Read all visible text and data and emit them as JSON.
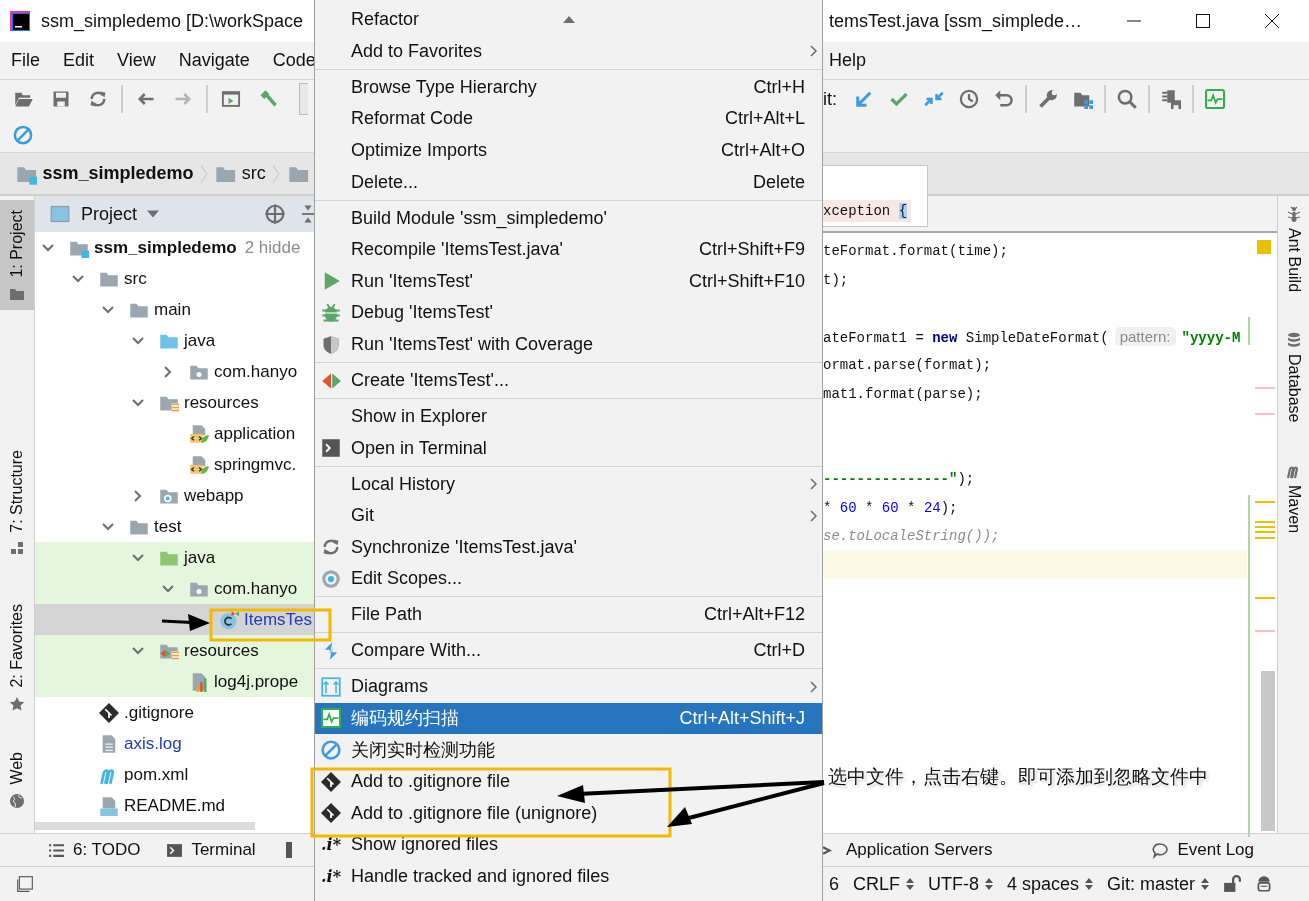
{
  "title_bar": {
    "left_title": "ssm_simpledemo [D:\\workSpace",
    "right_title": "temsTest.java [ssm_simplede…"
  },
  "menu_bar": {
    "left": [
      "File",
      "Edit",
      "View",
      "Navigate",
      "Code"
    ],
    "right": [
      "Help"
    ]
  },
  "toolbar": {
    "vcs_label": "it:"
  },
  "breadcrumb": [
    "ssm_simpledemo",
    "src"
  ],
  "left_stripe": [
    {
      "label": "1: Project",
      "selected": true
    },
    {
      "label": "7: Structure",
      "selected": false
    },
    {
      "label": "2: Favorites",
      "selected": false
    },
    {
      "label": "Web",
      "selected": false
    }
  ],
  "project_panel": {
    "title": "Project",
    "tree": [
      {
        "label": "ssm_simpledemo",
        "note": "2 hidde",
        "kind": "module",
        "expanded": true,
        "selected": false,
        "tinted": false,
        "modified": false,
        "children": [
          {
            "label": "src",
            "kind": "folder",
            "expanded": true,
            "selected": false,
            "tinted": false,
            "modified": false,
            "children": [
              {
                "label": "main",
                "kind": "folder",
                "expanded": true,
                "selected": false,
                "tinted": false,
                "modified": false,
                "children": [
                  {
                    "label": "java",
                    "kind": "source-root",
                    "expanded": true,
                    "selected": false,
                    "tinted": false,
                    "modified": false,
                    "children": [
                      {
                        "label": "com.hanyo",
                        "kind": "package",
                        "expanded": false,
                        "selected": false,
                        "tinted": false,
                        "modified": false
                      }
                    ]
                  },
                  {
                    "label": "resources",
                    "kind": "resources",
                    "expanded": true,
                    "selected": false,
                    "tinted": false,
                    "modified": false,
                    "children": [
                      {
                        "label": "application",
                        "kind": "spring-xml",
                        "selected": false,
                        "tinted": false,
                        "modified": false
                      },
                      {
                        "label": "springmvc.",
                        "kind": "spring-xml",
                        "selected": false,
                        "tinted": false,
                        "modified": false
                      }
                    ]
                  },
                  {
                    "label": "webapp",
                    "kind": "web-folder",
                    "expanded": false,
                    "selected": false,
                    "tinted": false,
                    "modified": false
                  }
                ]
              },
              {
                "label": "test",
                "kind": "folder",
                "expanded": true,
                "selected": false,
                "tinted": false,
                "modified": false,
                "children": [
                  {
                    "label": "java",
                    "kind": "test-root",
                    "expanded": true,
                    "selected": false,
                    "tinted": true,
                    "modified": false,
                    "children": [
                      {
                        "label": "com.hanyo",
                        "kind": "package",
                        "expanded": true,
                        "selected": false,
                        "tinted": true,
                        "modified": false,
                        "children": [
                          {
                            "label": "ItemsTes",
                            "kind": "test-class",
                            "selected": true,
                            "tinted": false,
                            "modified": true
                          }
                        ]
                      }
                    ]
                  },
                  {
                    "label": "resources",
                    "kind": "test-resources",
                    "expanded": true,
                    "selected": false,
                    "tinted": true,
                    "modified": false,
                    "children": [
                      {
                        "label": "log4j.prope",
                        "kind": "properties",
                        "selected": false,
                        "tinted": true,
                        "modified": false
                      }
                    ]
                  }
                ]
              }
            ]
          },
          {
            "label": ".gitignore",
            "kind": "git",
            "selected": false,
            "tinted": false,
            "modified": false
          },
          {
            "label": "axis.log",
            "kind": "log",
            "selected": false,
            "tinted": false,
            "modified": true
          },
          {
            "label": "pom.xml",
            "kind": "maven",
            "selected": false,
            "tinted": false,
            "modified": false
          },
          {
            "label": "README.md",
            "kind": "markdown",
            "selected": false,
            "tinted": false,
            "modified": false
          }
        ]
      }
    ]
  },
  "editor": {
    "sticky_line": {
      "text": "xception",
      "brace": "{"
    },
    "lines": [
      {
        "current": false,
        "tokens": [
          {
            "text": "teFormat.format(time);",
            "kind": "plain"
          }
        ]
      },
      {
        "current": false,
        "tokens": [
          {
            "text": "t);",
            "kind": "plain"
          }
        ]
      },
      {
        "current": false
      },
      {
        "current": false,
        "tokens": [
          {
            "text": "ateFormat1 = ",
            "kind": "plain"
          },
          {
            "text": "new",
            "kind": "keyword"
          },
          {
            "text": " SimpleDateFormat(",
            "kind": "plain"
          },
          {
            "text": "pattern:",
            "kind": "hint"
          },
          {
            "text": "\"yyyy-M",
            "kind": "string"
          }
        ]
      },
      {
        "current": false,
        "tokens": [
          {
            "text": "ormat.parse(format);",
            "kind": "plain"
          }
        ]
      },
      {
        "current": false,
        "tokens": [
          {
            "text": "mat1.format(parse);",
            "kind": "plain"
          }
        ]
      },
      {
        "current": false
      },
      {
        "current": false
      },
      {
        "current": false,
        "tokens": [
          {
            "text": "---------------\"",
            "kind": "string"
          },
          {
            "text": ");",
            "kind": "plain"
          }
        ]
      },
      {
        "current": false,
        "tokens": [
          {
            "text": "* ",
            "kind": "plain"
          },
          {
            "text": "60",
            "kind": "number"
          },
          {
            "text": " * ",
            "kind": "plain"
          },
          {
            "text": "60",
            "kind": "number"
          },
          {
            "text": " * ",
            "kind": "plain"
          },
          {
            "text": "24",
            "kind": "number"
          },
          {
            "text": ");",
            "kind": "plain"
          }
        ]
      },
      {
        "current": false,
        "tokens": [
          {
            "text": "se.toLocaleString());",
            "kind": "deprecated"
          }
        ]
      },
      {
        "current": true
      }
    ]
  },
  "right_stripe": [
    {
      "label": "Ant Build",
      "kind": "ant"
    },
    {
      "label": "Database",
      "kind": "database"
    },
    {
      "label": "Maven",
      "kind": "maven"
    }
  ],
  "tool_windows": {
    "left": [
      {
        "label": "6: TODO",
        "kind": "list"
      },
      {
        "label": "Terminal",
        "kind": "terminal"
      }
    ],
    "right": [
      {
        "label": "Application Servers",
        "kind": "servers"
      },
      {
        "label": "Event Log",
        "kind": "bubble"
      }
    ]
  },
  "status_bar": {
    "items": [
      {
        "text": "6",
        "dropdown": false
      },
      {
        "text": "CRLF",
        "dropdown": true
      },
      {
        "text": "UTF-8",
        "dropdown": true
      },
      {
        "text": "4 spaces",
        "dropdown": true
      },
      {
        "text": "Git: master",
        "dropdown": true
      }
    ]
  },
  "context_menu": {
    "scroll_up": true,
    "groups": [
      [
        {
          "label": "Refactor",
          "submenu": false,
          "selected": false
        },
        {
          "label": "Add to Favorites",
          "submenu": true,
          "selected": false
        }
      ],
      [
        {
          "label": "Browse Type Hierarchy",
          "shortcut": "Ctrl+H",
          "submenu": false,
          "selected": false
        },
        {
          "label": "Reformat Code",
          "shortcut": "Ctrl+Alt+L",
          "submenu": false,
          "selected": false
        },
        {
          "label": "Optimize Imports",
          "shortcut": "Ctrl+Alt+O",
          "submenu": false,
          "selected": false
        },
        {
          "label": "Delete...",
          "shortcut": "Delete",
          "submenu": false,
          "selected": false
        }
      ],
      [
        {
          "label": "Build Module 'ssm_simpledemo'",
          "submenu": false,
          "selected": false
        },
        {
          "label": "Recompile 'ItemsTest.java'",
          "shortcut": "Ctrl+Shift+F9",
          "submenu": false,
          "selected": false
        },
        {
          "label": "Run 'ItemsTest'",
          "shortcut": "Ctrl+Shift+F10",
          "kind": "run",
          "submenu": false,
          "selected": false
        },
        {
          "label": "Debug 'ItemsTest'",
          "kind": "debug",
          "submenu": false,
          "selected": false
        },
        {
          "label": "Run 'ItemsTest' with Coverage",
          "kind": "coverage",
          "submenu": false,
          "selected": false
        }
      ],
      [
        {
          "label": "Create 'ItemsTest'...",
          "kind": "create",
          "submenu": false,
          "selected": false
        }
      ],
      [
        {
          "label": "Show in Explorer",
          "submenu": false,
          "selected": false
        },
        {
          "label": "Open in Terminal",
          "kind": "terminal",
          "submenu": false,
          "selected": false
        }
      ],
      [
        {
          "label": "Local History",
          "submenu": true,
          "selected": false
        },
        {
          "label": "Git",
          "submenu": true,
          "selected": false
        },
        {
          "label": "Synchronize 'ItemsTest.java'",
          "kind": "sync",
          "submenu": false,
          "selected": false
        },
        {
          "label": "Edit Scopes...",
          "kind": "scope",
          "submenu": false,
          "selected": false
        }
      ],
      [
        {
          "label": "File Path",
          "shortcut": "Ctrl+Alt+F12",
          "submenu": false,
          "selected": false
        }
      ],
      [
        {
          "label": "Compare With...",
          "shortcut": "Ctrl+D",
          "kind": "compare",
          "submenu": false,
          "selected": false
        }
      ],
      [
        {
          "label": "Diagrams",
          "kind": "diagram",
          "submenu": true,
          "selected": false
        },
        {
          "label": "编码规约扫描",
          "shortcut": "Ctrl+Alt+Shift+J",
          "kind": "pulse",
          "submenu": false,
          "selected": true
        },
        {
          "label": "关闭实时检测功能",
          "kind": "forbid",
          "submenu": false,
          "selected": false
        },
        {
          "label": "Add to .gitignore file",
          "kind": "git",
          "submenu": false,
          "selected": false
        },
        {
          "label": "Add to .gitignore file (unignore)",
          "kind": "git",
          "submenu": false,
          "selected": false
        },
        {
          "label": "Show ignored files",
          "icon_text": ".i*",
          "submenu": false,
          "selected": false
        },
        {
          "label": "Handle tracked and ignored files",
          "icon_text": ".i*",
          "submenu": false,
          "selected": false
        }
      ]
    ]
  },
  "annotation": {
    "text": "选中文件，点击右键。即可添加到忽略文件中"
  }
}
